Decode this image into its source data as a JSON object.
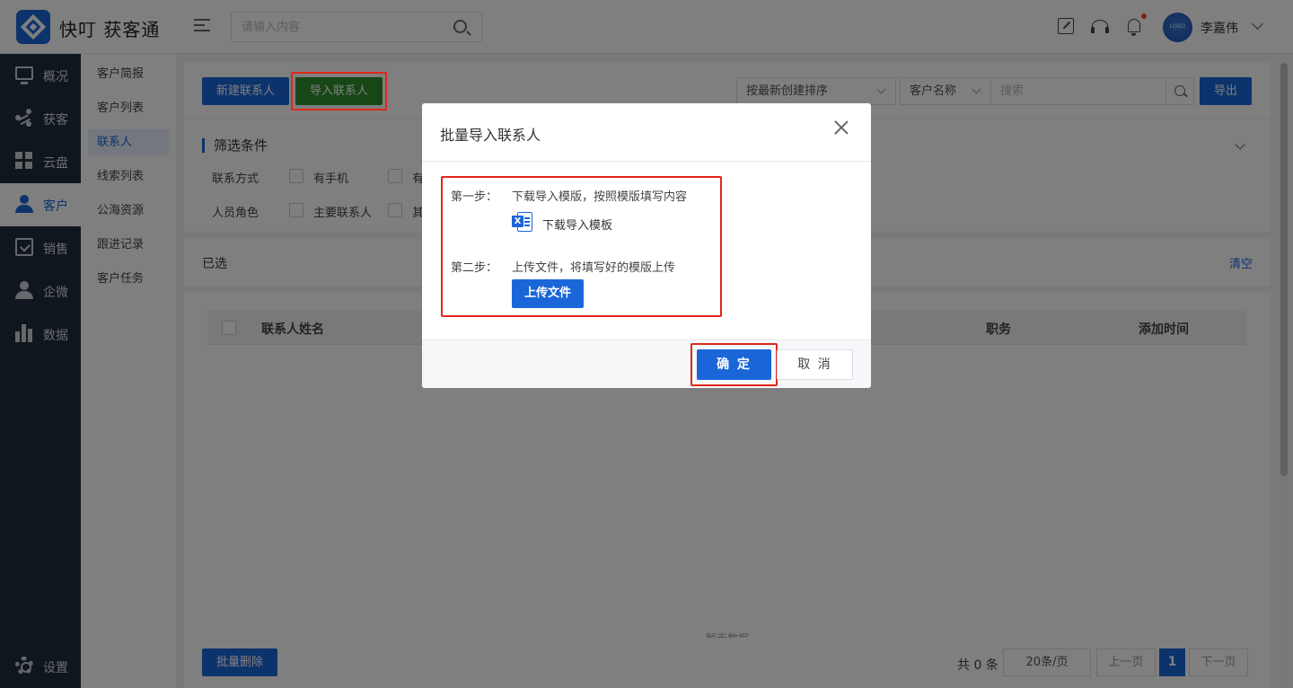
{
  "app": {
    "brand": "快叮 获客通"
  },
  "header": {
    "search_placeholder": "请输入内容",
    "user_name": "李嘉伟",
    "icons": [
      "edit-icon",
      "headset-icon",
      "bell-icon"
    ],
    "notification_dot_color": "#f04134"
  },
  "sidebar": {
    "items": [
      {
        "label": "概况",
        "icon": "monitor-icon"
      },
      {
        "label": "获客",
        "icon": "share-icon"
      },
      {
        "label": "云盘",
        "icon": "grid-icon"
      },
      {
        "label": "客户",
        "icon": "user-icon",
        "active": true
      },
      {
        "label": "销售",
        "icon": "clipboard-check-icon"
      },
      {
        "label": "企微",
        "icon": "person-icon"
      },
      {
        "label": "数据",
        "icon": "bar-chart-icon"
      }
    ],
    "settings_label": "设置"
  },
  "submenu": {
    "items": [
      "客户简报",
      "客户列表",
      "联系人",
      "线索列表",
      "公海资源",
      "跟进记录",
      "客户任务"
    ],
    "active_index": 2
  },
  "toolbar": {
    "new_contact": "新建联系人",
    "import_contact": "导入联系人",
    "sort_select": "按最新创建排序",
    "field_select": "客户名称",
    "search_placeholder": "搜索",
    "export": "导出"
  },
  "filters": {
    "title": "筛选条件",
    "rows": [
      {
        "label": "联系方式",
        "options": [
          "有手机",
          "有"
        ]
      },
      {
        "label": "人员角色",
        "options": [
          "主要联系人",
          "其"
        ]
      }
    ]
  },
  "selection": {
    "label": "已选",
    "clear": "清空"
  },
  "table": {
    "columns": [
      "联系人姓名",
      "职务",
      "添加时间"
    ],
    "empty_text": "暂无数据"
  },
  "footer": {
    "batch_delete": "批量删除",
    "total": "共 0 条",
    "page_size": "20条/页",
    "prev": "上一页",
    "current_page": "1",
    "next": "下一页"
  },
  "modal": {
    "title": "批量导入联系人",
    "step1_label": "第一步：",
    "step1_text": "下载导入模版，按照模版填写内容",
    "download_link": "下载导入模板",
    "step2_label": "第二步：",
    "step2_text": "上传文件，将填写好的模版上传",
    "upload_button": "上传文件",
    "confirm": "确 定",
    "cancel": "取 消"
  },
  "colors": {
    "accent": "#1a66d9",
    "import_green": "#2f8f2f",
    "highlight_red": "#e0271c",
    "sidebar_bg": "#1f2d3d"
  }
}
